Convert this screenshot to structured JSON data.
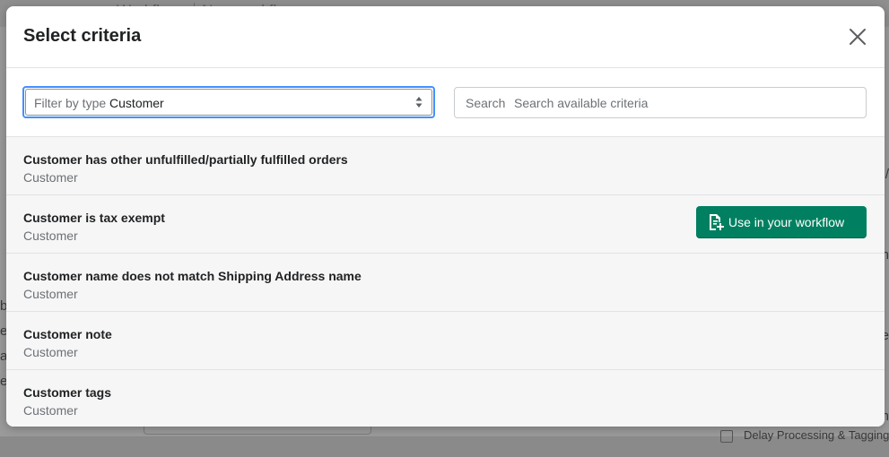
{
  "background": {
    "breadcrumb_left": "Workflows",
    "breadcrumb_right": "New workflow",
    "left_letters": [
      "b",
      "e",
      "a",
      "e"
    ],
    "right_letters": [
      "/",
      "h",
      "e",
      "h"
    ],
    "bottom_checkbox_label": "Delay Processing & Tagging"
  },
  "modal": {
    "title": "Select criteria",
    "close_icon": "close-icon",
    "filter": {
      "label": "Filter by type",
      "value": "Customer"
    },
    "search": {
      "label": "Search",
      "placeholder": "Search available criteria",
      "value": ""
    },
    "items": [
      {
        "title": "Customer has other unfulfilled/partially fulfilled orders",
        "type": "Customer"
      },
      {
        "title": "Customer is tax exempt",
        "type": "Customer"
      },
      {
        "title": "Customer name does not match Shipping Address name",
        "type": "Customer"
      },
      {
        "title": "Customer note",
        "type": "Customer"
      },
      {
        "title": "Customer tags",
        "type": "Customer"
      }
    ],
    "use_button": {
      "label": "Use in your workflow",
      "icon": "add-document-icon",
      "color": "#008060"
    }
  }
}
